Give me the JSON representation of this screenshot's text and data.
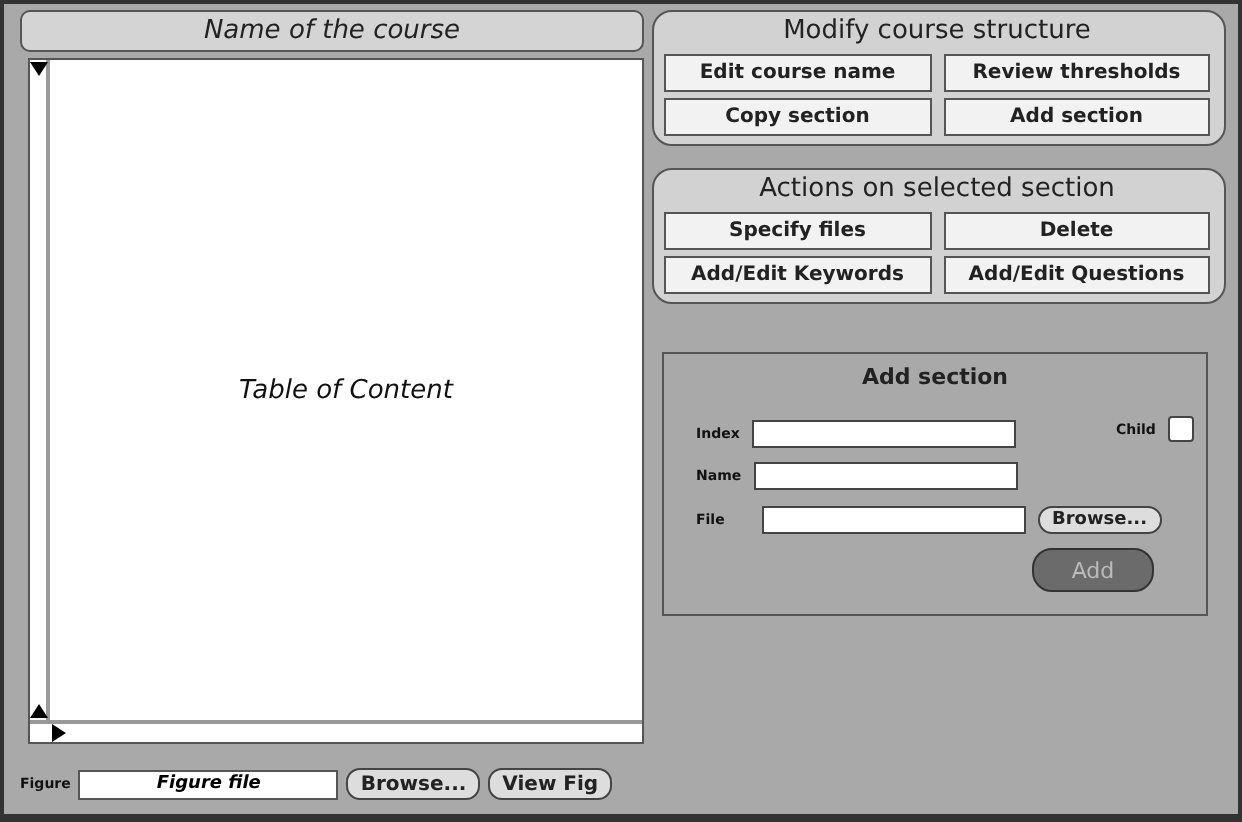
{
  "course_title": "Name of the course",
  "table_of_content": {
    "text": "Table of Content"
  },
  "figure": {
    "label": "Figure",
    "value": "Figure file",
    "browse": "Browse...",
    "view": "View Fig"
  },
  "modify_group": {
    "title": "Modify course structure",
    "buttons": [
      "Edit course name",
      "Review thresholds",
      "Copy section",
      "Add section"
    ]
  },
  "actions_group": {
    "title": "Actions on selected section",
    "buttons": [
      "Specify files",
      "Delete",
      "Add/Edit Keywords",
      "Add/Edit Questions"
    ]
  },
  "add_section": {
    "title": "Add section",
    "index_label": "Index",
    "child_label": "Child",
    "child_checked": false,
    "name_label": "Name",
    "file_label": "File",
    "browse": "Browse...",
    "add_button": {
      "label": "Add",
      "disabled": true
    }
  }
}
